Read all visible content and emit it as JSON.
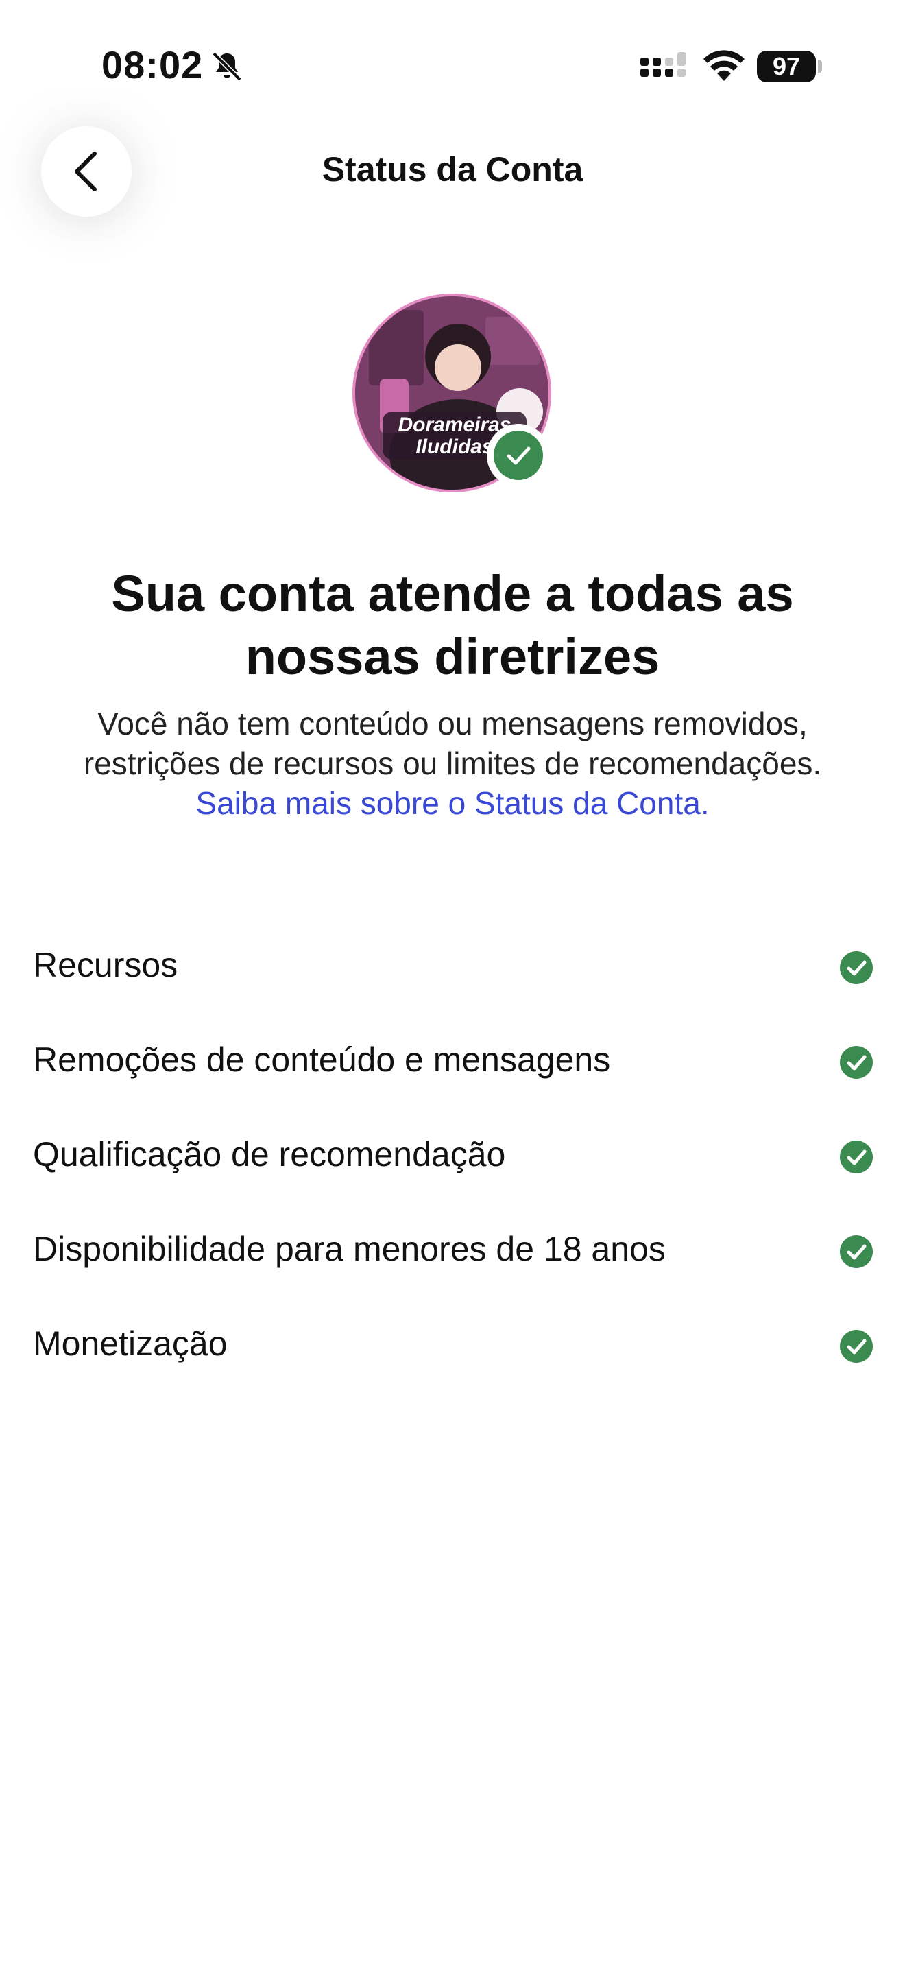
{
  "status_bar": {
    "time": "08:02",
    "battery": "97",
    "icons": [
      "bell-slash-icon",
      "cellular-signal-icon",
      "wifi-icon",
      "battery-icon"
    ]
  },
  "header": {
    "title": "Status da Conta",
    "back_icon": "chevron-left-icon"
  },
  "avatar": {
    "text": "Dorameiras Iludidas",
    "badge_icon": "check-circle-icon"
  },
  "headline": "Sua conta atende a todas as nossas diretrizes",
  "description": {
    "text": "Você não tem conteúdo ou mensagens removidos, restrições de recursos ou limites de recomendações.",
    "link": "Saiba mais sobre o Status da Conta."
  },
  "status_items": [
    {
      "label": "Recursos"
    },
    {
      "label": "Remoções de conteúdo e mensagens"
    },
    {
      "label": "Qualificação de recomendação"
    },
    {
      "label": "Disponibilidade para menores de 18 anos"
    },
    {
      "label": "Monetização"
    }
  ],
  "colors": {
    "check_green": "#3b8a4f",
    "link_blue": "#3a48d6",
    "avatar_border": "#e68cc4"
  }
}
